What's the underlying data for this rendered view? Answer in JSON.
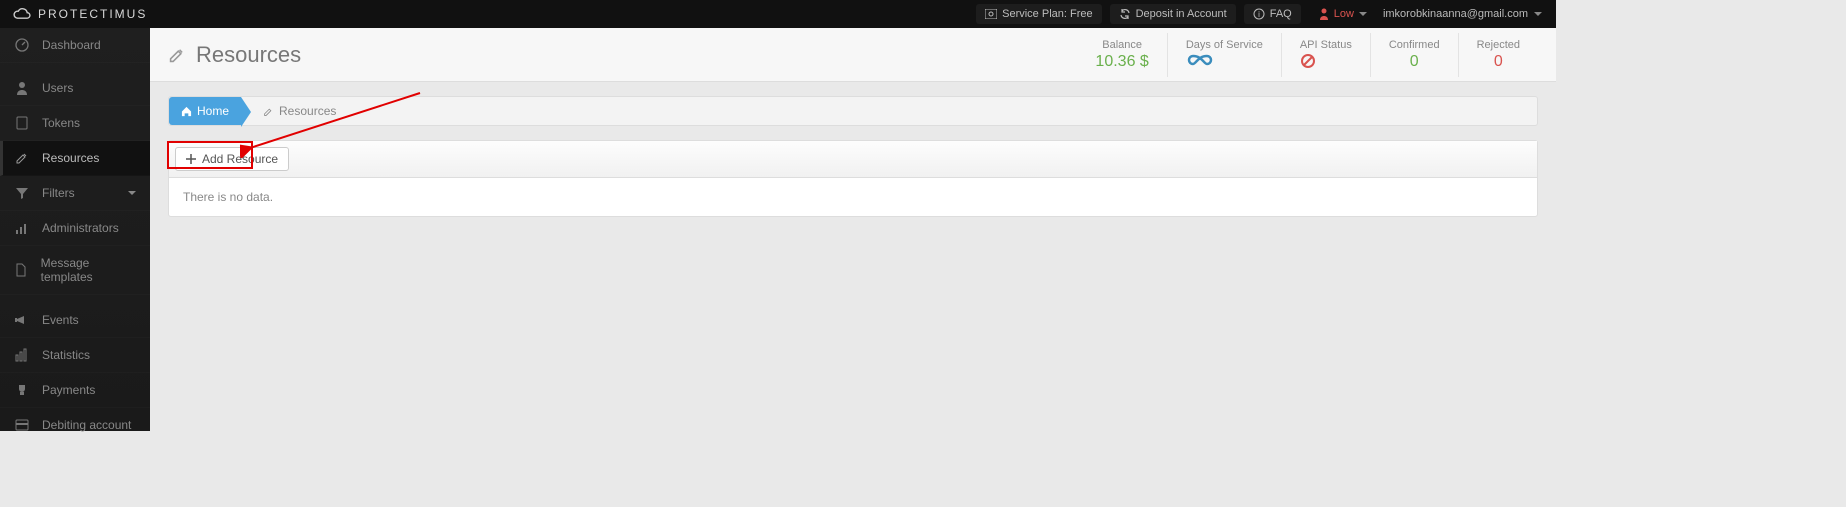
{
  "brand": "PROTECTIMUS",
  "topbar": {
    "service_plan": "Service Plan: Free",
    "deposit": "Deposit in Account",
    "faq": "FAQ",
    "alert_label": "Low",
    "user_email": "imkorobkinaanna@gmail.com"
  },
  "sidebar": {
    "items": [
      {
        "icon": "dashboard",
        "label": "Dashboard"
      },
      {
        "icon": "user",
        "label": "Users"
      },
      {
        "icon": "tablet",
        "label": "Tokens"
      },
      {
        "icon": "edit",
        "label": "Resources"
      },
      {
        "icon": "filter",
        "label": "Filters",
        "caret": true
      },
      {
        "icon": "signal",
        "label": "Administrators"
      },
      {
        "icon": "file",
        "label": "Message templates"
      },
      {
        "icon": "bullhorn",
        "label": "Events"
      },
      {
        "icon": "bar",
        "label": "Statistics"
      },
      {
        "icon": "trophy",
        "label": "Payments"
      },
      {
        "icon": "card",
        "label": "Debiting account"
      }
    ]
  },
  "page": {
    "title": "Resources",
    "breadcrumb_home": "Home",
    "breadcrumb_current": "Resources",
    "add_button": "Add Resource",
    "empty_text": "There is no data."
  },
  "stats": {
    "balance_label": "Balance",
    "balance_value": "10.36 $",
    "days_label": "Days of Service",
    "days_value": "∞",
    "api_label": "API Status",
    "api_value": "⊘",
    "confirmed_label": "Confirmed",
    "confirmed_value": "0",
    "rejected_label": "Rejected",
    "rejected_value": "0"
  }
}
